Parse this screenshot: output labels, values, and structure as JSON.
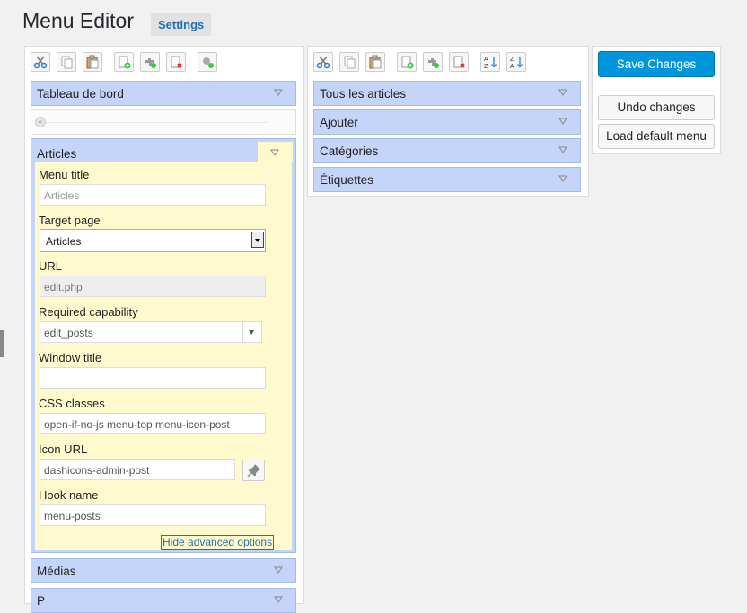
{
  "header": {
    "title": "Menu Editor",
    "settings_label": "Settings"
  },
  "menu_toolbar": [
    "cut-icon",
    "copy-icon",
    "paste-icon",
    "new-menu-icon",
    "new-separator-icon",
    "delete-icon",
    "add-item-icon"
  ],
  "sub_toolbar": [
    "cut-icon",
    "copy-icon",
    "paste-icon",
    "new-item-icon",
    "new-separator-icon",
    "delete-icon",
    "sort-ascending-icon",
    "sort-descending-icon"
  ],
  "menu_items": {
    "top": "Tableau de bord",
    "open": "Articles",
    "bottom": [
      "Médias",
      "P"
    ]
  },
  "editor": {
    "menu_title_label": "Menu title",
    "menu_title_placeholder": "Articles",
    "target_page_label": "Target page",
    "target_page_value": "Articles",
    "url_label": "URL",
    "url_value": "edit.php",
    "capability_label": "Required capability",
    "capability_value": "edit_posts",
    "window_title_label": "Window title",
    "window_title_value": "",
    "css_label": "CSS classes",
    "css_value": "open-if-no-js menu-top menu-icon-post",
    "icon_url_label": "Icon URL",
    "icon_url_value": "dashicons-admin-post",
    "hook_label": "Hook name",
    "hook_value": "menu-posts",
    "advanced_link": "Hide advanced options"
  },
  "submenu_items": [
    "Tous les articles",
    "Ajouter",
    "Catégories",
    "Étiquettes"
  ],
  "actions": {
    "save": "Save Changes",
    "undo": "Undo changes",
    "load_default": "Load default menu"
  },
  "colors": {
    "item_bg": "#c5d5f9",
    "editor_bg": "#fffacd",
    "primary": "#0096dd",
    "link": "#2271b1"
  }
}
